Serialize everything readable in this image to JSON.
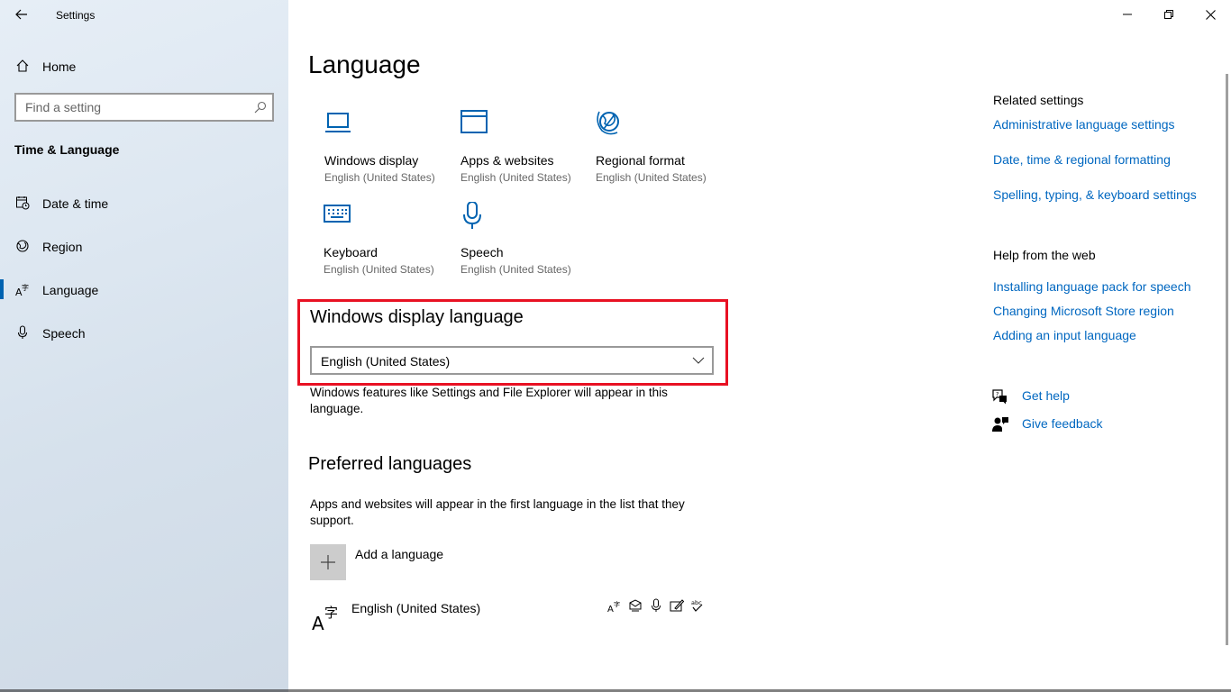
{
  "app": {
    "title": "Settings"
  },
  "sidebar": {
    "home_label": "Home",
    "search_placeholder": "Find a setting",
    "section_title": "Time & Language",
    "items": [
      {
        "label": "Date & time",
        "icon": "calendar-clock-icon"
      },
      {
        "label": "Region",
        "icon": "globe-region-icon"
      },
      {
        "label": "Language",
        "icon": "language-icon",
        "active": true
      },
      {
        "label": "Speech",
        "icon": "microphone-icon"
      }
    ]
  },
  "main": {
    "title": "Language",
    "tiles": [
      {
        "name": "Windows display",
        "sub": "English (United States)",
        "icon": "monitor-icon"
      },
      {
        "name": "Apps & websites",
        "sub": "English (United States)",
        "icon": "window-icon"
      },
      {
        "name": "Regional format",
        "sub": "English (United States)",
        "icon": "globe-icon"
      },
      {
        "name": "Keyboard",
        "sub": "English (United States)",
        "icon": "keyboard-icon"
      },
      {
        "name": "Speech",
        "sub": "English (United States)",
        "icon": "microphone-icon"
      }
    ],
    "display_language": {
      "heading": "Windows display language",
      "selected": "English (United States)",
      "desc_line1": "Windows features like Settings and File Explorer will appear in this",
      "desc_line2": "language."
    },
    "preferred": {
      "heading": "Preferred languages",
      "desc_line1": "Apps and websites will appear in the first language in the list that they",
      "desc_line2": "support.",
      "add_label": "Add a language",
      "languages": [
        {
          "name": "English (United States)",
          "features": [
            "display-language-icon",
            "text-to-speech-icon",
            "speech-recognition-icon",
            "handwriting-icon",
            "spell-check-icon"
          ]
        }
      ]
    }
  },
  "related": {
    "heading": "Related settings",
    "links": [
      "Administrative language settings",
      "Date, time & regional formatting",
      "Spelling, typing, & keyboard settings"
    ]
  },
  "help": {
    "heading": "Help from the web",
    "links": [
      "Installing language pack for speech",
      "Changing Microsoft Store region",
      "Adding an input language"
    ]
  },
  "support": {
    "get_help": "Get help",
    "give_feedback": "Give feedback"
  },
  "colors": {
    "accent": "#0067c0",
    "highlight_border": "#e81123",
    "tile_icon": "#0063b1"
  }
}
